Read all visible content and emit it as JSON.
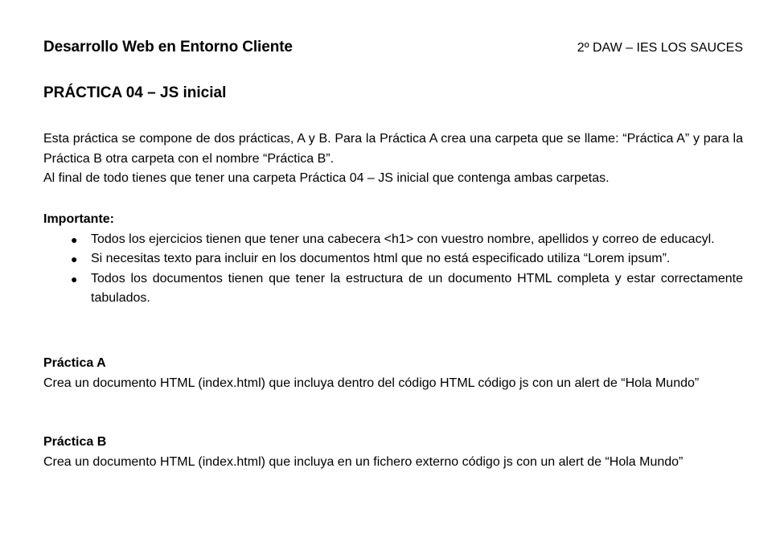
{
  "header": {
    "course_title": "Desarrollo Web en Entorno Cliente",
    "course_info": "2º DAW – IES LOS SAUCES"
  },
  "practice": {
    "title": "PRÁCTICA 04 – JS inicial"
  },
  "intro": {
    "paragraph_1": "Esta práctica se compone de dos prácticas, A y B. Para la Práctica A crea una carpeta que se llame: “Práctica A” y para la Práctica B otra carpeta con el nombre “Práctica B”.",
    "paragraph_2": "Al final de todo tienes que tener una carpeta Práctica 04 – JS inicial que contenga ambas carpetas."
  },
  "important": {
    "label": "Importante:",
    "bullet_symbol": "●",
    "items": [
      "Todos los ejercicios tienen que tener una cabecera <h1> con vuestro nombre, apellidos y correo de educacyl.",
      "Si necesitas texto para incluir en los documentos html que no está especificado utiliza “Lorem ipsum”.",
      "Todos los documentos tienen que tener la estructura de un documento HTML completa y estar correctamente tabulados."
    ]
  },
  "section_a": {
    "label": "Práctica A",
    "text": "Crea un documento HTML (index.html) que incluya dentro del código HTML código js con un alert de “Hola Mundo”"
  },
  "section_b": {
    "label": "Práctica B",
    "text": "Crea un documento HTML (index.html) que incluya en un fichero externo código js con un alert de “Hola Mundo”"
  }
}
